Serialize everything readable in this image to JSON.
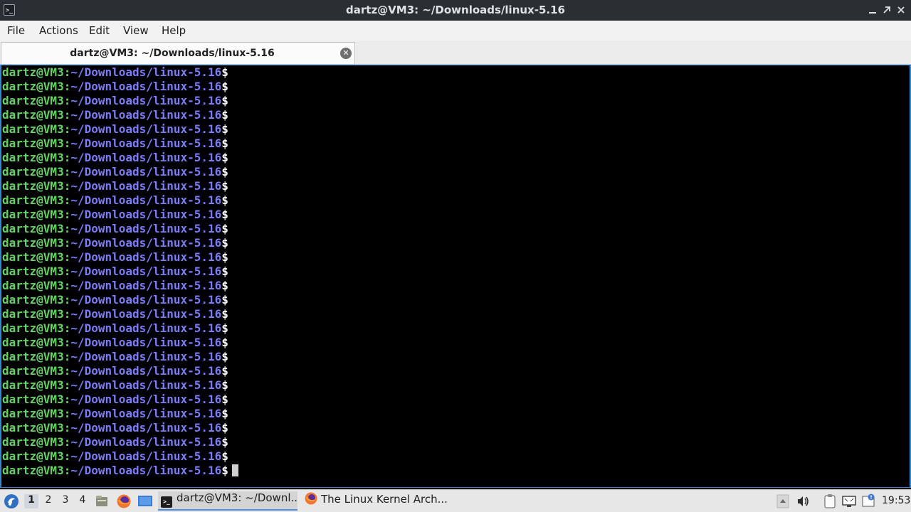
{
  "window": {
    "title": "dartz@VM3: ~/Downloads/linux-5.16",
    "app_icon": "terminal-icon",
    "controls": [
      "minimize-icon",
      "restore-icon",
      "close-icon"
    ]
  },
  "menubar": {
    "items": [
      "File",
      "Actions",
      "Edit",
      "View",
      "Help"
    ]
  },
  "tab": {
    "label": "dartz@VM3: ~/Downloads/linux-5.16",
    "close_icon": "close-circle-icon"
  },
  "terminal": {
    "prompt_user": "dartz@VM3",
    "prompt_sep": ":",
    "prompt_path": "~/Downloads/linux-5.16",
    "prompt_symbol": "$",
    "line_count": 29,
    "colors": {
      "user": "#5fd75f",
      "path": "#7b7bff",
      "background": "#000000",
      "focus_border": "#2c8ad6"
    }
  },
  "taskbar": {
    "start_icon": "app-menu-icon",
    "workspaces": [
      "1",
      "2",
      "3",
      "4"
    ],
    "active_workspace": "1",
    "launchers": [
      "file-manager-icon",
      "firefox-icon",
      "desktop-icon"
    ],
    "tasks": [
      {
        "label": "dartz@VM3: ~/Downl...",
        "icon": "terminal-icon",
        "active": true
      },
      {
        "label": "The Linux Kernel Arch...",
        "icon": "firefox-icon",
        "active": false
      }
    ],
    "tray": [
      "tray-up-arrow-icon",
      "volume-icon",
      "clipboard-icon",
      "network-icon",
      "update-icon"
    ],
    "clock": "19:53"
  }
}
